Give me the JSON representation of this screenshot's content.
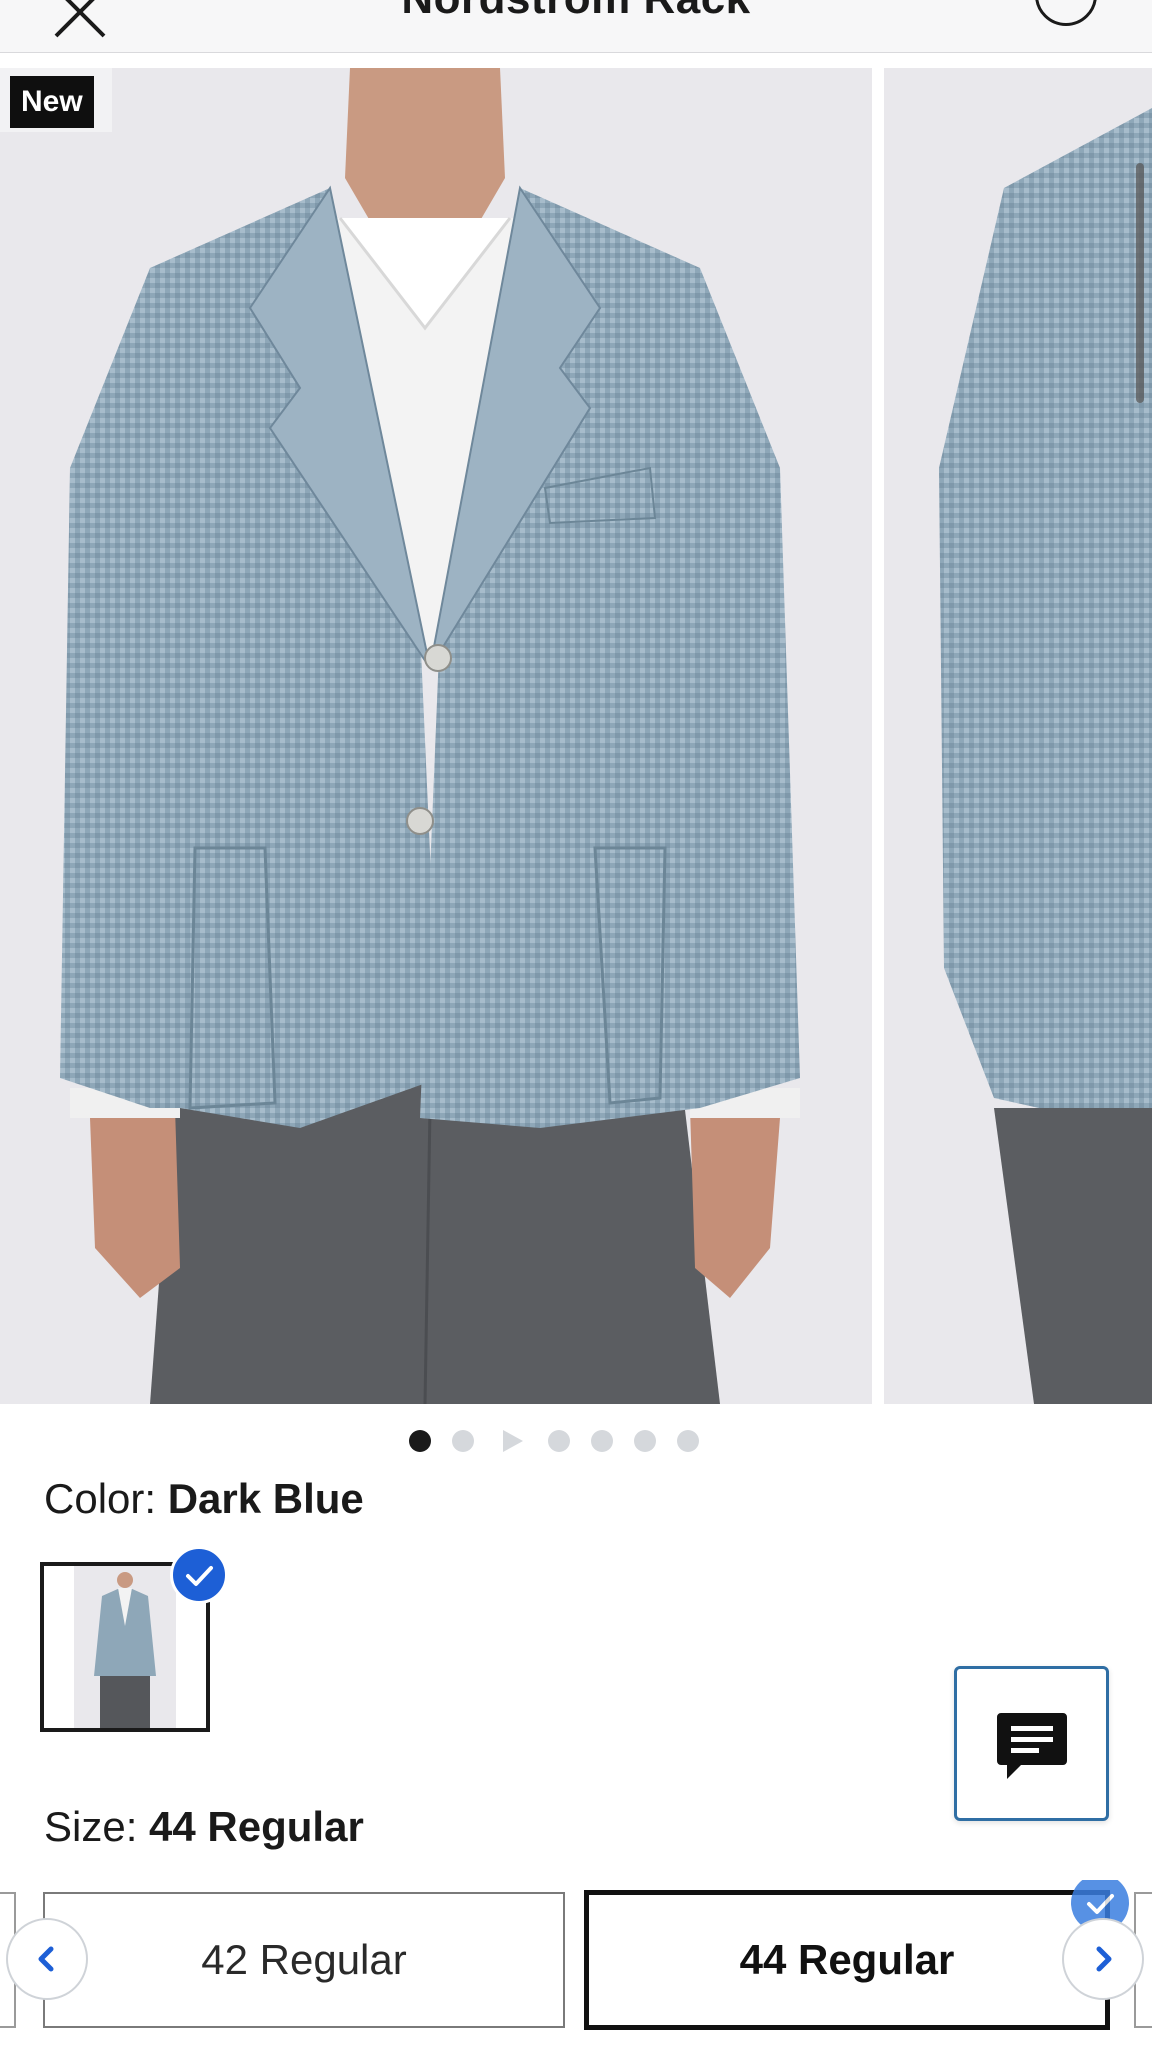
{
  "header": {
    "title": "Nordstrom Rack",
    "close_icon": "close-icon",
    "account_icon": "account-icon"
  },
  "gallery": {
    "badge": "New",
    "slides": 7,
    "active_index": 0,
    "video_slide_index": 2
  },
  "color": {
    "label": "Color:",
    "value": "Dark Blue",
    "swatch_selected": true
  },
  "chat": {
    "icon": "chat-icon"
  },
  "size": {
    "label": "Size:",
    "value": "44 Regular",
    "options": [
      {
        "label": "42 Regular",
        "selected": false
      },
      {
        "label": "44 Regular",
        "selected": true
      }
    ]
  },
  "colors": {
    "accent_blue": "#1d5fd6",
    "chat_border": "#2f6ea4",
    "text": "#1a1a1a"
  }
}
